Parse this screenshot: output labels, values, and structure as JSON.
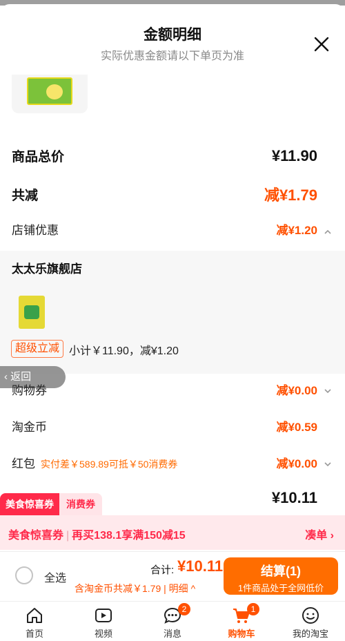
{
  "sheet": {
    "title": "金额明细",
    "subtitle": "实际优惠金额请以下单页为准"
  },
  "summary": {
    "goods_total_label": "商品总价",
    "goods_total_value": "¥11.90",
    "total_reduce_label": "共减",
    "total_reduce_value": "减¥1.79",
    "store_discount_label": "店铺优惠",
    "store_discount_value": "减¥1.20"
  },
  "store": {
    "name": "太太乐旗舰店",
    "promo_tag": "超级立减",
    "subtotal_text": "小计￥11.90，减¥1.20"
  },
  "back_button": "返回",
  "discounts": [
    {
      "label": "购物券",
      "value": "减¥0.00",
      "note": ""
    },
    {
      "label": "淘金币",
      "value": "减¥0.59",
      "note": ""
    },
    {
      "label": "红包",
      "value": "减¥0.00",
      "note": "实付差￥589.89可抵￥50消费券"
    }
  ],
  "final_value": "¥10.11",
  "promo": {
    "tag1": "美食惊喜券",
    "tag2": "消费券",
    "bar_title": "美食惊喜券",
    "bar_text": "再买138.1享满150减15",
    "action": "凑单"
  },
  "checkout": {
    "select_all": "全选",
    "total_label": "合计:",
    "total_value": "¥10.11",
    "note": "含淘金币共减￥1.79 | 明细",
    "pay_label": "结算(1)",
    "pay_sub": "1件商品处于全网低价"
  },
  "tabbar": [
    {
      "label": "首页",
      "icon": "home-icon",
      "badge": ""
    },
    {
      "label": "视频",
      "icon": "video-icon",
      "badge": ""
    },
    {
      "label": "消息",
      "icon": "message-icon",
      "badge": "2"
    },
    {
      "label": "购物车",
      "icon": "cart-icon",
      "badge": "1"
    },
    {
      "label": "我的淘宝",
      "icon": "profile-icon",
      "badge": ""
    }
  ],
  "colors": {
    "accent": "#ff5000",
    "promo_red": "#ff2a4a",
    "pay_button": "#ff6d00"
  }
}
